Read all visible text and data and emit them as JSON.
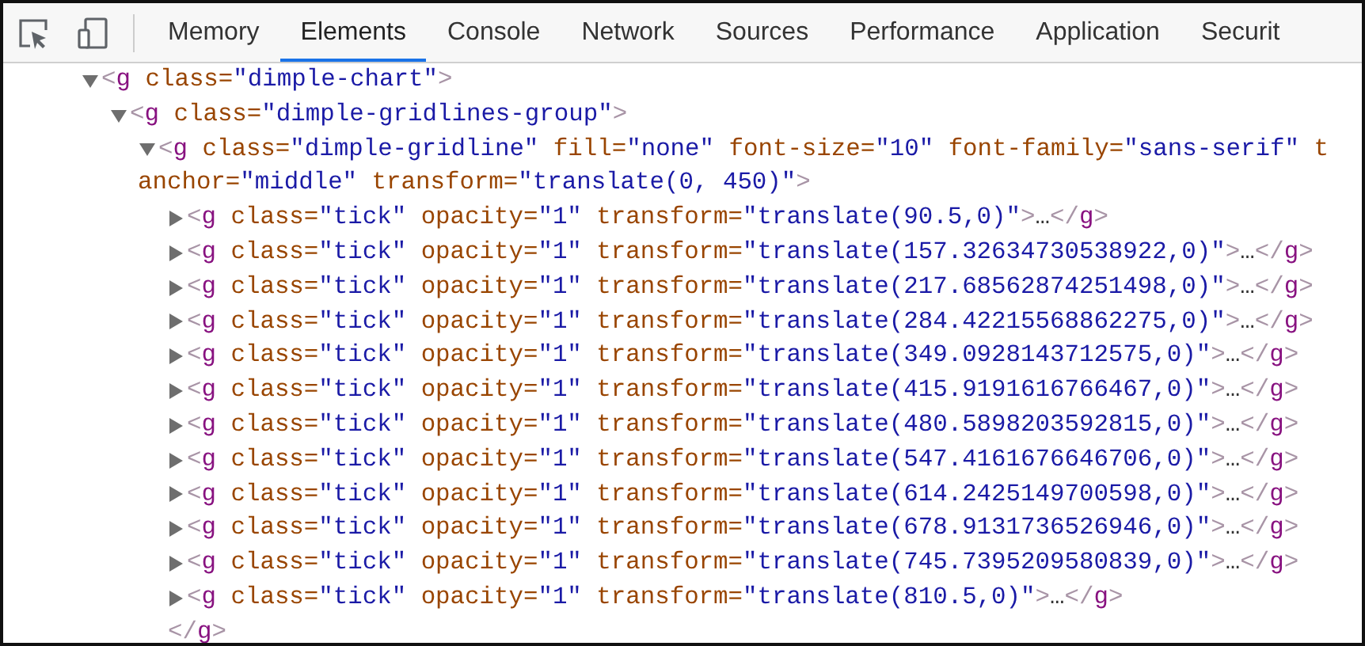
{
  "toolbar": {
    "tabs": [
      {
        "label": "Memory",
        "selected": false
      },
      {
        "label": "Elements",
        "selected": true
      },
      {
        "label": "Console",
        "selected": false
      },
      {
        "label": "Network",
        "selected": false
      },
      {
        "label": "Sources",
        "selected": false
      },
      {
        "label": "Performance",
        "selected": false
      },
      {
        "label": "Application",
        "selected": false
      },
      {
        "label": "Securit",
        "selected": false
      }
    ]
  },
  "tree": [
    {
      "expanded": true,
      "lines": [
        [
          {
            "kind": "punct",
            "text": "<"
          },
          {
            "kind": "tag",
            "text": "g"
          },
          {
            "kind": "attr",
            "text": " class="
          },
          {
            "kind": "value",
            "text": "\"dimple-chart\""
          },
          {
            "kind": "punct",
            "text": ">"
          }
        ]
      ],
      "children": [
        {
          "expanded": true,
          "lines": [
            [
              {
                "kind": "punct",
                "text": "<"
              },
              {
                "kind": "tag",
                "text": "g"
              },
              {
                "kind": "attr",
                "text": " class="
              },
              {
                "kind": "value",
                "text": "\"dimple-gridlines-group\""
              },
              {
                "kind": "punct",
                "text": ">"
              }
            ]
          ],
          "children": [
            {
              "expanded": true,
              "lines": [
                [
                  {
                    "kind": "punct",
                    "text": "<"
                  },
                  {
                    "kind": "tag",
                    "text": "g"
                  },
                  {
                    "kind": "attr",
                    "text": " class="
                  },
                  {
                    "kind": "value",
                    "text": "\"dimple-gridline\""
                  },
                  {
                    "kind": "attr",
                    "text": " fill="
                  },
                  {
                    "kind": "value",
                    "text": "\"none\""
                  },
                  {
                    "kind": "attr",
                    "text": " font-size="
                  },
                  {
                    "kind": "value",
                    "text": "\"10\""
                  },
                  {
                    "kind": "attr",
                    "text": " font-family="
                  },
                  {
                    "kind": "value",
                    "text": "\"sans-serif\""
                  },
                  {
                    "kind": "attr",
                    "text": " t"
                  }
                ],
                [
                  {
                    "kind": "attr",
                    "text": "anchor="
                  },
                  {
                    "kind": "value",
                    "text": "\"middle\""
                  },
                  {
                    "kind": "attr",
                    "text": " transform="
                  },
                  {
                    "kind": "value",
                    "text": "\"translate(0, 450)\""
                  },
                  {
                    "kind": "punct",
                    "text": ">"
                  }
                ]
              ],
              "closing": [
                {
                  "kind": "punct",
                  "text": "</"
                },
                {
                  "kind": "tag",
                  "text": "g"
                },
                {
                  "kind": "punct",
                  "text": ">"
                }
              ],
              "children": [
                {
                  "expanded": false,
                  "lines": [
                    [
                      {
                        "kind": "punct",
                        "text": "<"
                      },
                      {
                        "kind": "tag",
                        "text": "g"
                      },
                      {
                        "kind": "attr",
                        "text": " class="
                      },
                      {
                        "kind": "value",
                        "text": "\"tick\""
                      },
                      {
                        "kind": "attr",
                        "text": " opacity="
                      },
                      {
                        "kind": "value",
                        "text": "\"1\""
                      },
                      {
                        "kind": "attr",
                        "text": " transform="
                      },
                      {
                        "kind": "value",
                        "text": "\"translate(90.5,0)\""
                      },
                      {
                        "kind": "punct",
                        "text": ">"
                      },
                      {
                        "kind": "ellipsis",
                        "text": "…"
                      },
                      {
                        "kind": "punct",
                        "text": "</"
                      },
                      {
                        "kind": "tag",
                        "text": "g"
                      },
                      {
                        "kind": "punct",
                        "text": ">"
                      }
                    ]
                  ]
                },
                {
                  "expanded": false,
                  "lines": [
                    [
                      {
                        "kind": "punct",
                        "text": "<"
                      },
                      {
                        "kind": "tag",
                        "text": "g"
                      },
                      {
                        "kind": "attr",
                        "text": " class="
                      },
                      {
                        "kind": "value",
                        "text": "\"tick\""
                      },
                      {
                        "kind": "attr",
                        "text": " opacity="
                      },
                      {
                        "kind": "value",
                        "text": "\"1\""
                      },
                      {
                        "kind": "attr",
                        "text": " transform="
                      },
                      {
                        "kind": "value",
                        "text": "\"translate(157.32634730538922,0)\""
                      },
                      {
                        "kind": "punct",
                        "text": ">"
                      },
                      {
                        "kind": "ellipsis",
                        "text": "…"
                      },
                      {
                        "kind": "punct",
                        "text": "</"
                      },
                      {
                        "kind": "tag",
                        "text": "g"
                      },
                      {
                        "kind": "punct",
                        "text": ">"
                      }
                    ]
                  ]
                },
                {
                  "expanded": false,
                  "lines": [
                    [
                      {
                        "kind": "punct",
                        "text": "<"
                      },
                      {
                        "kind": "tag",
                        "text": "g"
                      },
                      {
                        "kind": "attr",
                        "text": " class="
                      },
                      {
                        "kind": "value",
                        "text": "\"tick\""
                      },
                      {
                        "kind": "attr",
                        "text": " opacity="
                      },
                      {
                        "kind": "value",
                        "text": "\"1\""
                      },
                      {
                        "kind": "attr",
                        "text": " transform="
                      },
                      {
                        "kind": "value",
                        "text": "\"translate(217.68562874251498,0)\""
                      },
                      {
                        "kind": "punct",
                        "text": ">"
                      },
                      {
                        "kind": "ellipsis",
                        "text": "…"
                      },
                      {
                        "kind": "punct",
                        "text": "</"
                      },
                      {
                        "kind": "tag",
                        "text": "g"
                      },
                      {
                        "kind": "punct",
                        "text": ">"
                      }
                    ]
                  ]
                },
                {
                  "expanded": false,
                  "lines": [
                    [
                      {
                        "kind": "punct",
                        "text": "<"
                      },
                      {
                        "kind": "tag",
                        "text": "g"
                      },
                      {
                        "kind": "attr",
                        "text": " class="
                      },
                      {
                        "kind": "value",
                        "text": "\"tick\""
                      },
                      {
                        "kind": "attr",
                        "text": " opacity="
                      },
                      {
                        "kind": "value",
                        "text": "\"1\""
                      },
                      {
                        "kind": "attr",
                        "text": " transform="
                      },
                      {
                        "kind": "value",
                        "text": "\"translate(284.42215568862275,0)\""
                      },
                      {
                        "kind": "punct",
                        "text": ">"
                      },
                      {
                        "kind": "ellipsis",
                        "text": "…"
                      },
                      {
                        "kind": "punct",
                        "text": "</"
                      },
                      {
                        "kind": "tag",
                        "text": "g"
                      },
                      {
                        "kind": "punct",
                        "text": ">"
                      }
                    ]
                  ]
                },
                {
                  "expanded": false,
                  "lines": [
                    [
                      {
                        "kind": "punct",
                        "text": "<"
                      },
                      {
                        "kind": "tag",
                        "text": "g"
                      },
                      {
                        "kind": "attr",
                        "text": " class="
                      },
                      {
                        "kind": "value",
                        "text": "\"tick\""
                      },
                      {
                        "kind": "attr",
                        "text": " opacity="
                      },
                      {
                        "kind": "value",
                        "text": "\"1\""
                      },
                      {
                        "kind": "attr",
                        "text": " transform="
                      },
                      {
                        "kind": "value",
                        "text": "\"translate(349.0928143712575,0)\""
                      },
                      {
                        "kind": "punct",
                        "text": ">"
                      },
                      {
                        "kind": "ellipsis",
                        "text": "…"
                      },
                      {
                        "kind": "punct",
                        "text": "</"
                      },
                      {
                        "kind": "tag",
                        "text": "g"
                      },
                      {
                        "kind": "punct",
                        "text": ">"
                      }
                    ]
                  ]
                },
                {
                  "expanded": false,
                  "lines": [
                    [
                      {
                        "kind": "punct",
                        "text": "<"
                      },
                      {
                        "kind": "tag",
                        "text": "g"
                      },
                      {
                        "kind": "attr",
                        "text": " class="
                      },
                      {
                        "kind": "value",
                        "text": "\"tick\""
                      },
                      {
                        "kind": "attr",
                        "text": " opacity="
                      },
                      {
                        "kind": "value",
                        "text": "\"1\""
                      },
                      {
                        "kind": "attr",
                        "text": " transform="
                      },
                      {
                        "kind": "value",
                        "text": "\"translate(415.9191616766467,0)\""
                      },
                      {
                        "kind": "punct",
                        "text": ">"
                      },
                      {
                        "kind": "ellipsis",
                        "text": "…"
                      },
                      {
                        "kind": "punct",
                        "text": "</"
                      },
                      {
                        "kind": "tag",
                        "text": "g"
                      },
                      {
                        "kind": "punct",
                        "text": ">"
                      }
                    ]
                  ]
                },
                {
                  "expanded": false,
                  "lines": [
                    [
                      {
                        "kind": "punct",
                        "text": "<"
                      },
                      {
                        "kind": "tag",
                        "text": "g"
                      },
                      {
                        "kind": "attr",
                        "text": " class="
                      },
                      {
                        "kind": "value",
                        "text": "\"tick\""
                      },
                      {
                        "kind": "attr",
                        "text": " opacity="
                      },
                      {
                        "kind": "value",
                        "text": "\"1\""
                      },
                      {
                        "kind": "attr",
                        "text": " transform="
                      },
                      {
                        "kind": "value",
                        "text": "\"translate(480.5898203592815,0)\""
                      },
                      {
                        "kind": "punct",
                        "text": ">"
                      },
                      {
                        "kind": "ellipsis",
                        "text": "…"
                      },
                      {
                        "kind": "punct",
                        "text": "</"
                      },
                      {
                        "kind": "tag",
                        "text": "g"
                      },
                      {
                        "kind": "punct",
                        "text": ">"
                      }
                    ]
                  ]
                },
                {
                  "expanded": false,
                  "lines": [
                    [
                      {
                        "kind": "punct",
                        "text": "<"
                      },
                      {
                        "kind": "tag",
                        "text": "g"
                      },
                      {
                        "kind": "attr",
                        "text": " class="
                      },
                      {
                        "kind": "value",
                        "text": "\"tick\""
                      },
                      {
                        "kind": "attr",
                        "text": " opacity="
                      },
                      {
                        "kind": "value",
                        "text": "\"1\""
                      },
                      {
                        "kind": "attr",
                        "text": " transform="
                      },
                      {
                        "kind": "value",
                        "text": "\"translate(547.4161676646706,0)\""
                      },
                      {
                        "kind": "punct",
                        "text": ">"
                      },
                      {
                        "kind": "ellipsis",
                        "text": "…"
                      },
                      {
                        "kind": "punct",
                        "text": "</"
                      },
                      {
                        "kind": "tag",
                        "text": "g"
                      },
                      {
                        "kind": "punct",
                        "text": ">"
                      }
                    ]
                  ]
                },
                {
                  "expanded": false,
                  "lines": [
                    [
                      {
                        "kind": "punct",
                        "text": "<"
                      },
                      {
                        "kind": "tag",
                        "text": "g"
                      },
                      {
                        "kind": "attr",
                        "text": " class="
                      },
                      {
                        "kind": "value",
                        "text": "\"tick\""
                      },
                      {
                        "kind": "attr",
                        "text": " opacity="
                      },
                      {
                        "kind": "value",
                        "text": "\"1\""
                      },
                      {
                        "kind": "attr",
                        "text": " transform="
                      },
                      {
                        "kind": "value",
                        "text": "\"translate(614.2425149700598,0)\""
                      },
                      {
                        "kind": "punct",
                        "text": ">"
                      },
                      {
                        "kind": "ellipsis",
                        "text": "…"
                      },
                      {
                        "kind": "punct",
                        "text": "</"
                      },
                      {
                        "kind": "tag",
                        "text": "g"
                      },
                      {
                        "kind": "punct",
                        "text": ">"
                      }
                    ]
                  ]
                },
                {
                  "expanded": false,
                  "lines": [
                    [
                      {
                        "kind": "punct",
                        "text": "<"
                      },
                      {
                        "kind": "tag",
                        "text": "g"
                      },
                      {
                        "kind": "attr",
                        "text": " class="
                      },
                      {
                        "kind": "value",
                        "text": "\"tick\""
                      },
                      {
                        "kind": "attr",
                        "text": " opacity="
                      },
                      {
                        "kind": "value",
                        "text": "\"1\""
                      },
                      {
                        "kind": "attr",
                        "text": " transform="
                      },
                      {
                        "kind": "value",
                        "text": "\"translate(678.9131736526946,0)\""
                      },
                      {
                        "kind": "punct",
                        "text": ">"
                      },
                      {
                        "kind": "ellipsis",
                        "text": "…"
                      },
                      {
                        "kind": "punct",
                        "text": "</"
                      },
                      {
                        "kind": "tag",
                        "text": "g"
                      },
                      {
                        "kind": "punct",
                        "text": ">"
                      }
                    ]
                  ]
                },
                {
                  "expanded": false,
                  "lines": [
                    [
                      {
                        "kind": "punct",
                        "text": "<"
                      },
                      {
                        "kind": "tag",
                        "text": "g"
                      },
                      {
                        "kind": "attr",
                        "text": " class="
                      },
                      {
                        "kind": "value",
                        "text": "\"tick\""
                      },
                      {
                        "kind": "attr",
                        "text": " opacity="
                      },
                      {
                        "kind": "value",
                        "text": "\"1\""
                      },
                      {
                        "kind": "attr",
                        "text": " transform="
                      },
                      {
                        "kind": "value",
                        "text": "\"translate(745.7395209580839,0)\""
                      },
                      {
                        "kind": "punct",
                        "text": ">"
                      },
                      {
                        "kind": "ellipsis",
                        "text": "…"
                      },
                      {
                        "kind": "punct",
                        "text": "</"
                      },
                      {
                        "kind": "tag",
                        "text": "g"
                      },
                      {
                        "kind": "punct",
                        "text": ">"
                      }
                    ]
                  ]
                },
                {
                  "expanded": false,
                  "lines": [
                    [
                      {
                        "kind": "punct",
                        "text": "<"
                      },
                      {
                        "kind": "tag",
                        "text": "g"
                      },
                      {
                        "kind": "attr",
                        "text": " class="
                      },
                      {
                        "kind": "value",
                        "text": "\"tick\""
                      },
                      {
                        "kind": "attr",
                        "text": " opacity="
                      },
                      {
                        "kind": "value",
                        "text": "\"1\""
                      },
                      {
                        "kind": "attr",
                        "text": " transform="
                      },
                      {
                        "kind": "value",
                        "text": "\"translate(810.5,0)\""
                      },
                      {
                        "kind": "punct",
                        "text": ">"
                      },
                      {
                        "kind": "ellipsis",
                        "text": "…"
                      },
                      {
                        "kind": "punct",
                        "text": "</"
                      },
                      {
                        "kind": "tag",
                        "text": "g"
                      },
                      {
                        "kind": "punct",
                        "text": ">"
                      }
                    ]
                  ]
                }
              ]
            }
          ]
        }
      ]
    }
  ]
}
